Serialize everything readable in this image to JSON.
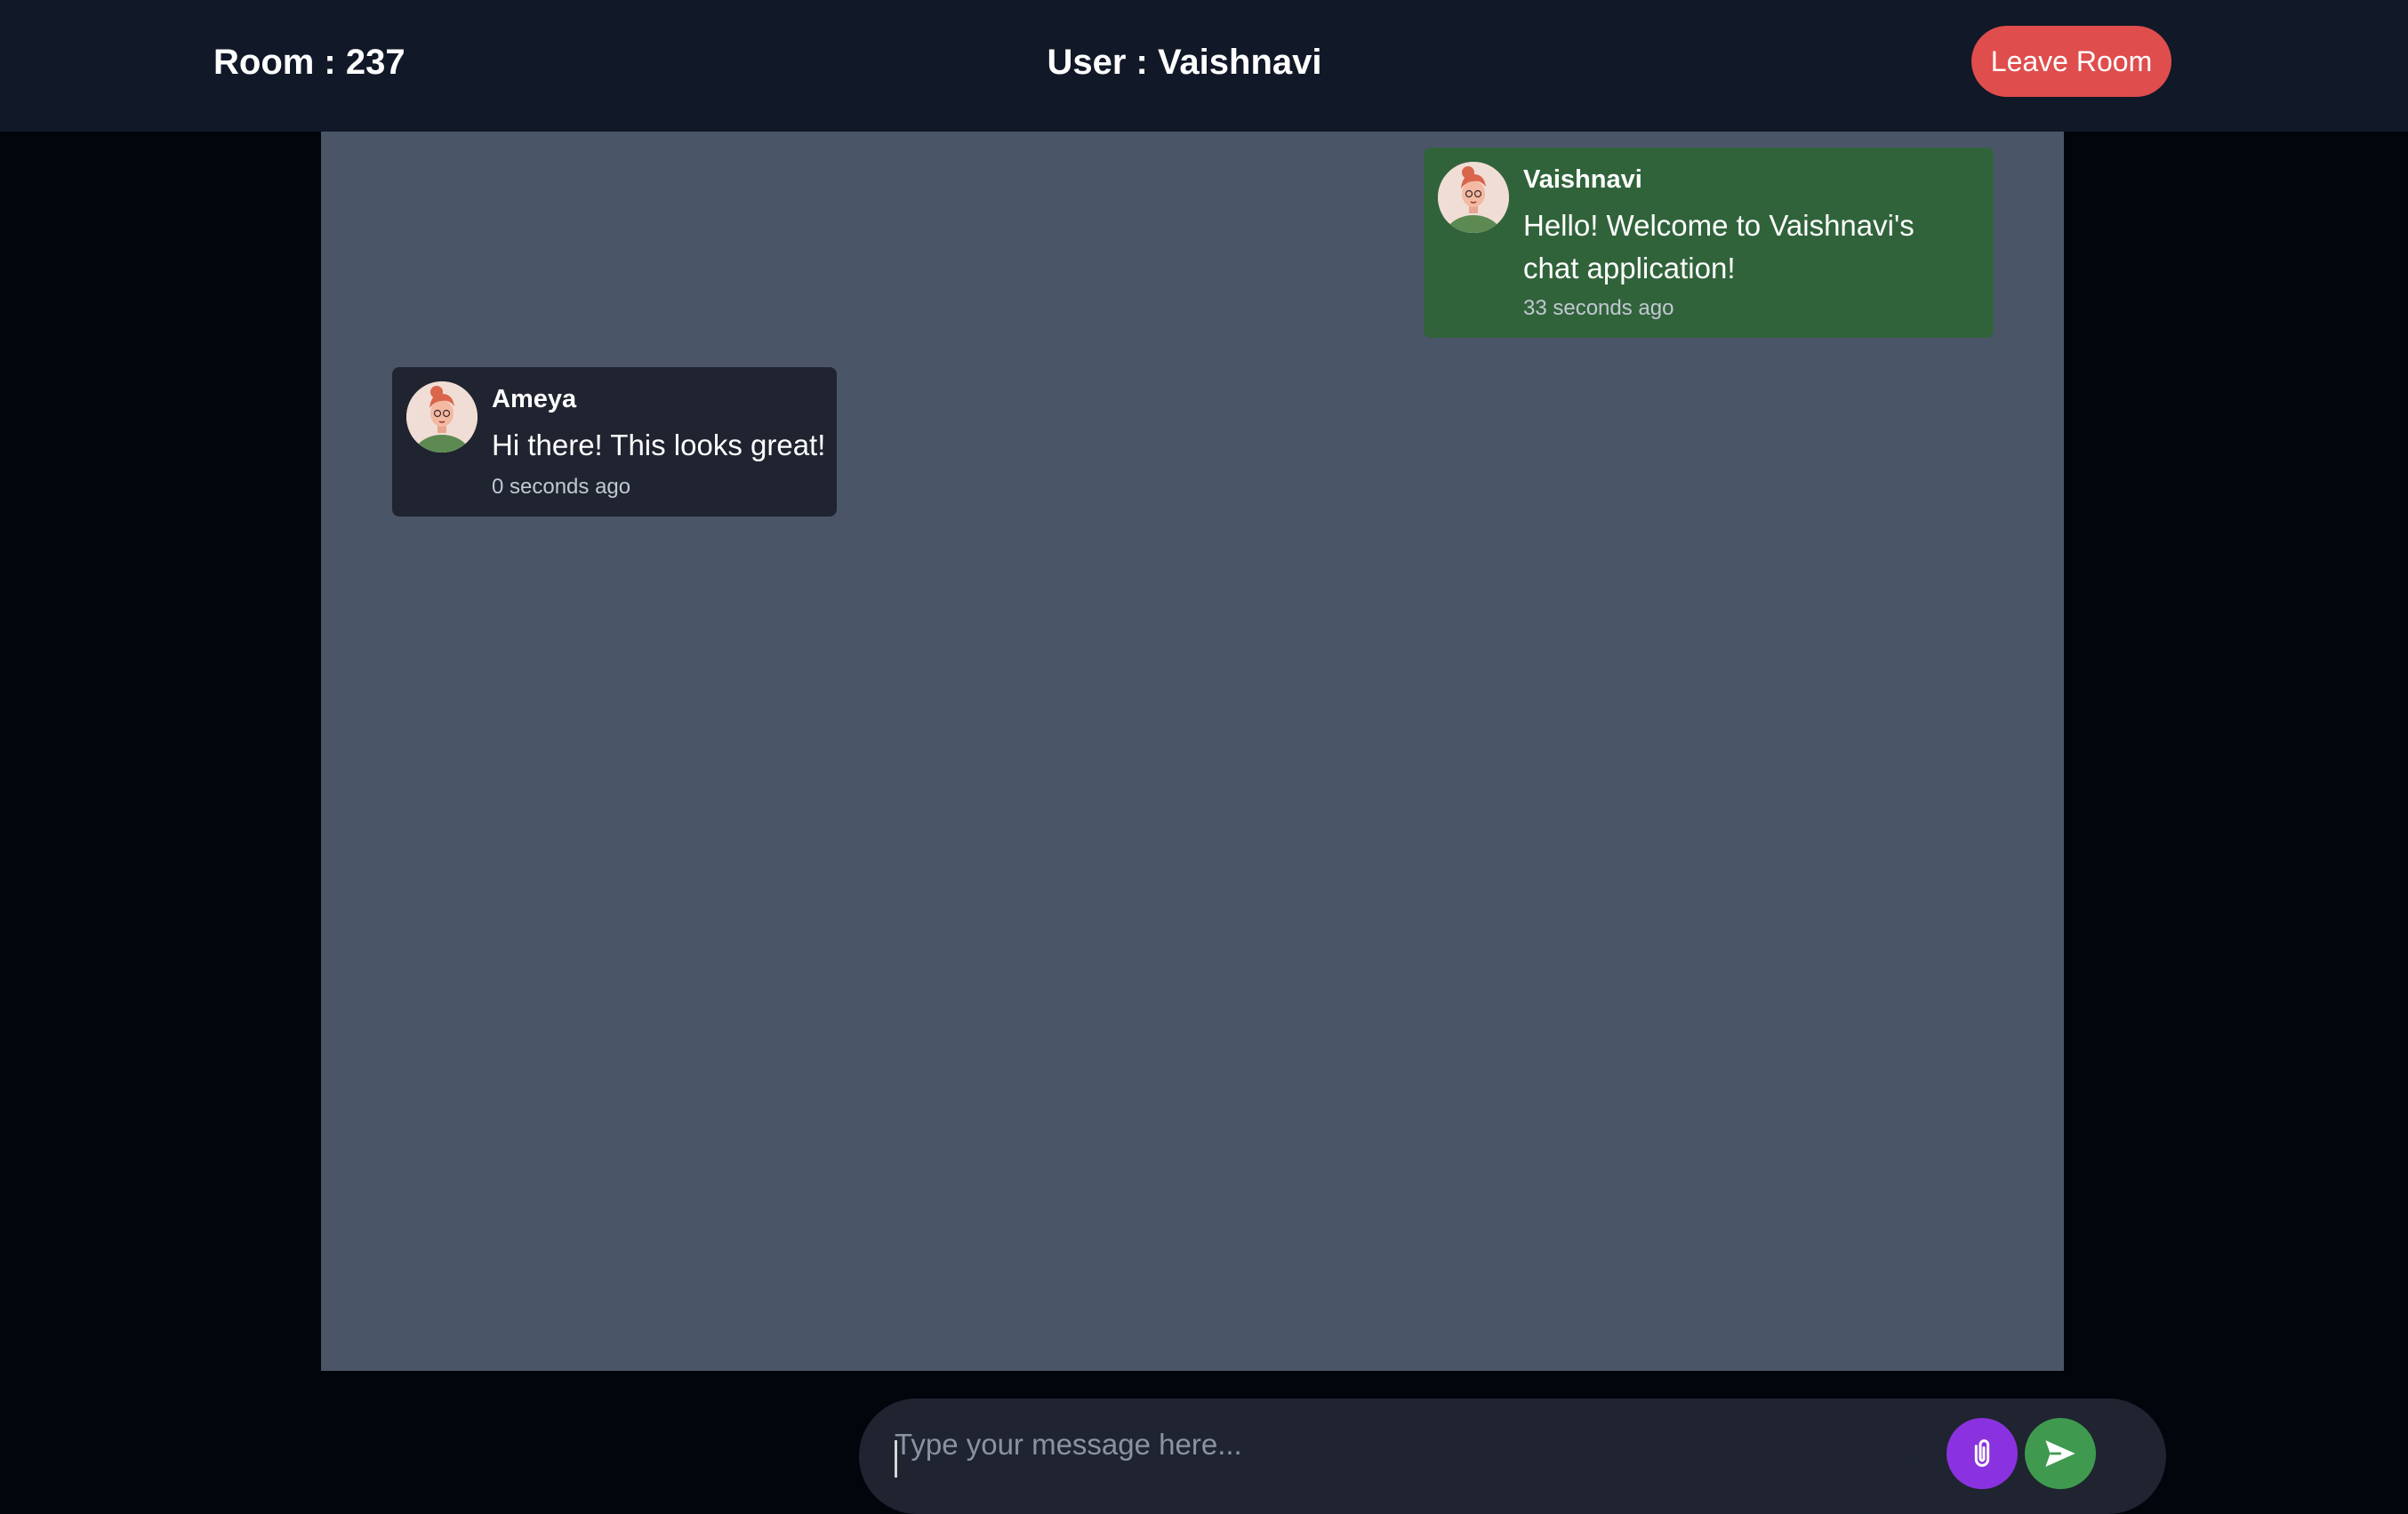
{
  "header": {
    "room_label": "Room : 237",
    "user_label": "User : Vaishnavi",
    "leave_button": "Leave Room"
  },
  "messages": [
    {
      "sender": "Vaishnavi",
      "text": "Hello! Welcome to Vaishnavi's chat application!",
      "time": "33 seconds ago",
      "own": true
    },
    {
      "sender": "Ameya",
      "text": "Hi there! This looks great!",
      "time": "0 seconds ago",
      "own": false
    }
  ],
  "composer": {
    "placeholder": "Type your message here...",
    "value": ""
  },
  "icons": {
    "attach": "paperclip-icon",
    "send": "send-icon",
    "avatar": "avatar-illustration"
  },
  "colors": {
    "header_bg": "#111827",
    "page_bg": "#03050d",
    "chat_bg": "#4a5568",
    "own_message_bg": "#31633b",
    "other_message_bg": "#1f2430",
    "leave_button": "#df4d4d",
    "attach_button": "#8a32df",
    "send_button": "#3f9a4f"
  }
}
